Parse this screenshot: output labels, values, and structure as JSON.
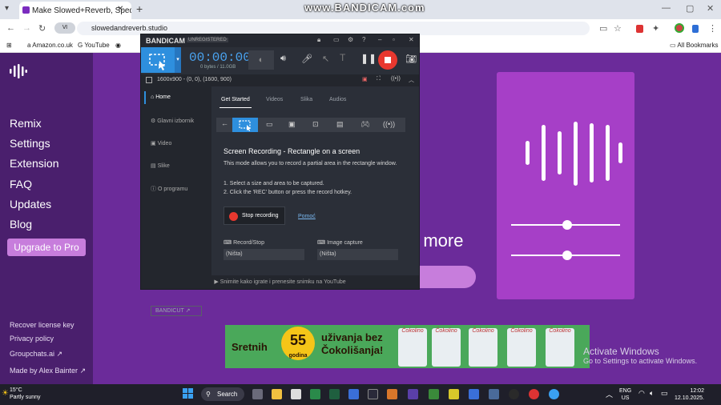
{
  "browser": {
    "tab_title": "Make Slowed+Reverb, Sped Up...",
    "url": "slowedandreverb.studio",
    "bookmarks": [
      "Amazon.co.uk",
      "YouTube"
    ],
    "all_bookmarks": "All Bookmarks",
    "watermark": "www.BANDICAM.com"
  },
  "site": {
    "nav": [
      "Remix",
      "Settings",
      "Extension",
      "FAQ",
      "Updates",
      "Blog"
    ],
    "upgrade": "Upgrade to Pro",
    "footer": [
      "Recover license key",
      "Privacy policy",
      "Groupchats.ai",
      "Made by Alex Bainter"
    ],
    "big_text": "d more",
    "colors": {
      "bg": "#3d1a5c",
      "card": "#a63fc7",
      "accent": "#c77ddc"
    }
  },
  "ad": {
    "left": "Sretnih",
    "badge": "55",
    "badge_sub": "godina",
    "right_line1": "uživanja bez",
    "right_line2": "Čokolišanja!",
    "brand": "Čokolino"
  },
  "activate": {
    "title": "Activate Windows",
    "sub": "Go to Settings to activate Windows."
  },
  "bandicam": {
    "logo": "BANDICAM",
    "unregistered": "UNREGISTERED",
    "time": "00:00:00",
    "size": "0 bytes / 11.0GB",
    "region": "1600x900 - (0, 0), (1600, 900)",
    "nav": [
      "Home",
      "Glavni izbornik",
      "Video",
      "Slike",
      "O programu"
    ],
    "tabs": [
      "Get Started",
      "Videos",
      "Slika",
      "Audios"
    ],
    "content_title": "Screen Recording - Rectangle on a screen",
    "content_desc": "This mode allows you to record a partial area in the rectangle window.",
    "step1": "1. Select a size and area to be captured.",
    "step2": "2. Click the 'REC' button or press the record hotkey.",
    "stop_label": "Stop recording",
    "help_label": "Pomoć",
    "hotkey1_label": "Record/Stop",
    "hotkey1_value": "(Ništa)",
    "hotkey2_label": "Image capture",
    "hotkey2_value": "(Ništa)",
    "bandicut": "BANDICUT ↗",
    "footer": "Snimite kako igrate i prenesite snimku na YouTube"
  },
  "taskbar": {
    "temp": "15°C",
    "weather": "Partly sunny",
    "search": "Search",
    "lang1": "ENG",
    "lang2": "US",
    "time": "12:02",
    "date": "12.10.2025."
  }
}
